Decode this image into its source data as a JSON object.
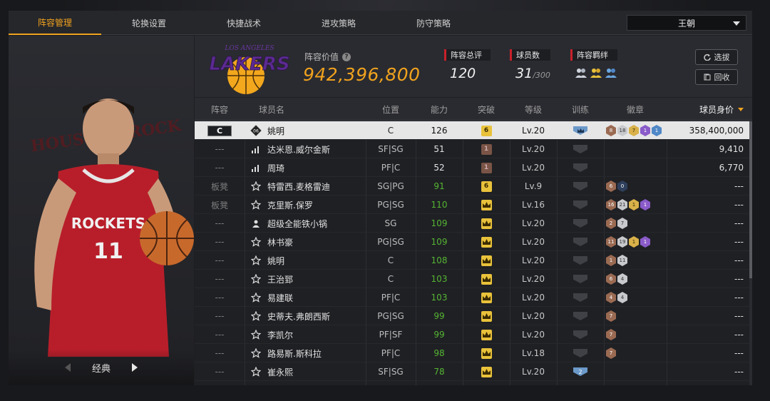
{
  "nav": {
    "tabs": [
      {
        "label": "阵容管理"
      },
      {
        "label": "轮换设置"
      },
      {
        "label": "快捷战术"
      },
      {
        "label": "进攻策略"
      },
      {
        "label": "防守策略"
      }
    ],
    "team": "王朝"
  },
  "left": {
    "style_label": "经典",
    "jersey_team": "ROCKETS",
    "jersey_number": "11",
    "background_text": "HOUSTON ROCK"
  },
  "summary": {
    "logo_text": "LAKERS",
    "logo_city": "LOS ANGELES",
    "value_label": "阵容价值",
    "value": "942,396,800",
    "rating_label": "阵容总评",
    "rating": "120",
    "count_label": "球员数",
    "count": "31",
    "count_max": "/300",
    "bond_label": "阵容羁绊",
    "select_btn": "选拔",
    "recycle_btn": "回收"
  },
  "table": {
    "headers": {
      "lineup": "阵容",
      "name": "球员名",
      "position": "位置",
      "ability": "能力",
      "breakthrough": "突破",
      "level": "等级",
      "training": "训练",
      "badges": "徽章",
      "value": "球员身价"
    },
    "rows": [
      {
        "lineup": "C",
        "name": "姚明",
        "position": "C",
        "ability": "126",
        "breakthrough": "6",
        "level": "Lv.20",
        "value": "358,400,000",
        "badges": [
          "8",
          "18",
          "7",
          "1",
          "1"
        ]
      },
      {
        "lineup": "---",
        "name": "达米恩.威尔金斯",
        "position": "SF|SG",
        "ability": "51",
        "breakthrough": "1",
        "level": "Lv.20",
        "value": "9,410",
        "badges": []
      },
      {
        "lineup": "---",
        "name": "周琦",
        "position": "PF|C",
        "ability": "52",
        "breakthrough": "1",
        "level": "Lv.20",
        "value": "6,770",
        "badges": []
      },
      {
        "lineup": "板凳",
        "name": "特雷西.麦格雷迪",
        "position": "SG|PG",
        "ability": "91",
        "breakthrough": "6",
        "level": "Lv.9",
        "value": "---",
        "badges": [
          "6",
          "0"
        ]
      },
      {
        "lineup": "板凳",
        "name": "克里斯.保罗",
        "position": "PG|SG",
        "ability": "110",
        "breakthrough": "",
        "level": "Lv.16",
        "value": "---",
        "badges": [
          "16",
          "21",
          "1",
          "1"
        ]
      },
      {
        "lineup": "---",
        "name": "超级全能铁小锅",
        "position": "SG",
        "ability": "109",
        "breakthrough": "",
        "level": "Lv.20",
        "value": "---",
        "badges": [
          "2",
          "7"
        ]
      },
      {
        "lineup": "---",
        "name": "林书豪",
        "position": "PG|SG",
        "ability": "109",
        "breakthrough": "",
        "level": "Lv.20",
        "value": "---",
        "badges": [
          "11",
          "19",
          "1",
          "1"
        ]
      },
      {
        "lineup": "---",
        "name": "姚明",
        "position": "C",
        "ability": "108",
        "breakthrough": "",
        "level": "Lv.20",
        "value": "---",
        "badges": [
          "1",
          "11"
        ]
      },
      {
        "lineup": "---",
        "name": "王治郅",
        "position": "C",
        "ability": "103",
        "breakthrough": "",
        "level": "Lv.20",
        "value": "---",
        "badges": [
          "6",
          "4"
        ]
      },
      {
        "lineup": "---",
        "name": "易建联",
        "position": "PF|C",
        "ability": "103",
        "breakthrough": "",
        "level": "Lv.20",
        "value": "---",
        "badges": [
          "4",
          "4"
        ]
      },
      {
        "lineup": "---",
        "name": "史蒂夫.弗朗西斯",
        "position": "PG|SG",
        "ability": "99",
        "breakthrough": "",
        "level": "Lv.20",
        "value": "---",
        "badges": [
          "7"
        ]
      },
      {
        "lineup": "---",
        "name": "李凯尔",
        "position": "PF|SF",
        "ability": "99",
        "breakthrough": "",
        "level": "Lv.20",
        "value": "---",
        "badges": [
          "7"
        ]
      },
      {
        "lineup": "---",
        "name": "路易斯.斯科拉",
        "position": "PF|C",
        "ability": "98",
        "breakthrough": "",
        "level": "Lv.18",
        "value": "---",
        "badges": [
          "7"
        ]
      },
      {
        "lineup": "---",
        "name": "崔永熙",
        "position": "SF|SG",
        "ability": "78",
        "breakthrough": "",
        "level": "Lv.20",
        "value": "---",
        "badges": [],
        "training": "2"
      }
    ]
  },
  "colors": {
    "accent": "#f0a21e",
    "red_marker": "#c8202a",
    "green_ability": "#55b532",
    "selected_row": "#e6e6e6"
  }
}
